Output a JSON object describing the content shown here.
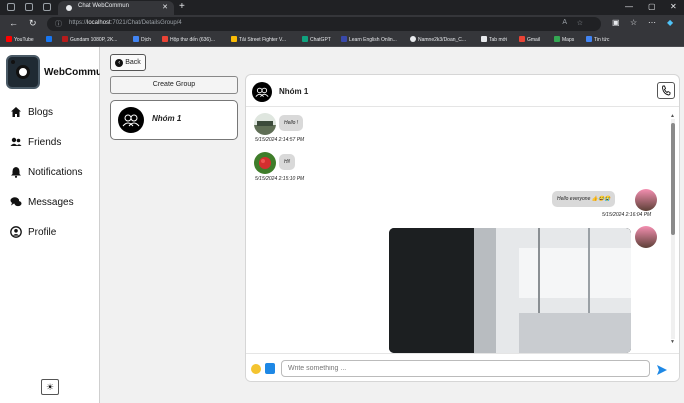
{
  "browser": {
    "tab_title": "Chat WebCommun",
    "url_host": "localhost",
    "url_prefix": "https://",
    "url_rest": ":7021/Chat/DetailsGroup/4",
    "bookmarks": [
      {
        "label": "YouTube",
        "color": "#ff0000"
      },
      {
        "label": "",
        "color": "#1877f2"
      },
      {
        "label": "Gundam 1080P, 2K...",
        "color": "#b71c1c"
      },
      {
        "label": "Dịch",
        "color": "#4285f4"
      },
      {
        "label": "Hộp thư đến (636)...",
        "color": "#ea4335"
      },
      {
        "label": "Tải Street Fighter V...",
        "color": "#fbbc05"
      },
      {
        "label": "ChatGPT",
        "color": "#10a37f"
      },
      {
        "label": "Learn English Onlin...",
        "color": "#3949ab"
      },
      {
        "label": "Namne2k3/Doan_C...",
        "color": "#e8eaed"
      },
      {
        "label": "Tab mới",
        "color": "#e8eaed"
      },
      {
        "label": "Gmail",
        "color": "#ea4335"
      },
      {
        "label": "Maps",
        "color": "#34a853"
      },
      {
        "label": "Tin tức",
        "color": "#4285f4"
      }
    ]
  },
  "sidebar": {
    "brand": "WebCommun",
    "items": [
      {
        "label": "Blogs",
        "icon": "home-icon"
      },
      {
        "label": "Friends",
        "icon": "users-icon"
      },
      {
        "label": "Notifications",
        "icon": "bell-icon"
      },
      {
        "label": "Messages",
        "icon": "comments-icon"
      },
      {
        "label": "Profile",
        "icon": "user-circle-icon"
      }
    ],
    "theme_toggle": "☀"
  },
  "main": {
    "back_label": "Back",
    "create_group_label": "Create Group",
    "groups": [
      {
        "name": "Nhóm 1"
      }
    ]
  },
  "chat": {
    "group_name": "Nhóm 1",
    "messages": [
      {
        "text": "Hello !",
        "time": "5/15/2024 2:14:57 PM",
        "side": "left"
      },
      {
        "text": "Hi!",
        "time": "5/15/2024 2:15:10 PM",
        "side": "left"
      },
      {
        "text": "Hello everyone 👍😂😭",
        "time": "5/15/2024 2:16:04 PM",
        "side": "right"
      }
    ],
    "input_placeholder": "Write something ..."
  },
  "colors": {
    "accent_blue": "#1e88e5",
    "bubble": "#d9d9d9",
    "background": "#f1f1f1"
  }
}
